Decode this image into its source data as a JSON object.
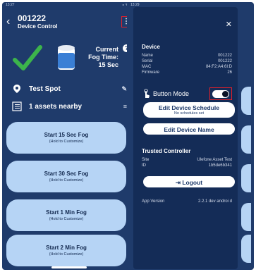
{
  "left": {
    "status_time": "13:27",
    "status_icons": "⁎ ᯤ.ıll",
    "title": "001222",
    "subtitle": "Device Control",
    "fog_label_line1": "Current",
    "fog_label_line2": "Fog Time:",
    "fog_label_line3": "15 Sec",
    "spot": "Test Spot",
    "assets": "1 assets nearby",
    "buttons": [
      {
        "main": "Start 15 Sec Fog",
        "sub": "(Hold to Customize)"
      },
      {
        "main": "Start 30 Sec Fog",
        "sub": "(Hold to Customize)"
      },
      {
        "main": "Start 1 Min Fog",
        "sub": "(Hold to Customize)"
      },
      {
        "main": "Start 2 Min Fog",
        "sub": "(Hold to Customize)"
      }
    ]
  },
  "right": {
    "status_time": "13:29",
    "device_title": "Device",
    "fields": [
      {
        "k": "Name",
        "v": "001222"
      },
      {
        "k": "Serial",
        "v": "001222"
      },
      {
        "k": "MAC",
        "v": "84:F2:A4:6I:D"
      },
      {
        "k": "Firmware",
        "v": "26"
      }
    ],
    "button_mode": "Button Mode",
    "button_mode_on": true,
    "edit_schedule": "Edit Device Schedule",
    "edit_schedule_sub": "No schedules set",
    "edit_name": "Edit Device Name",
    "trusted_title": "Trusted Controller",
    "trusted": [
      {
        "k": "Site",
        "v": "Ulefone Asset Test"
      },
      {
        "k": "ID",
        "v": "1b5de6b341"
      }
    ],
    "logout": "Logout",
    "app_version_label": "App Version",
    "app_version": "2.2.1 dev androi d"
  },
  "colors": {
    "background": "#1f3b6b",
    "drawer": "#142c57",
    "button": "#b6d4f5",
    "highlight": "#e0202b",
    "check": "#3cb44b"
  }
}
